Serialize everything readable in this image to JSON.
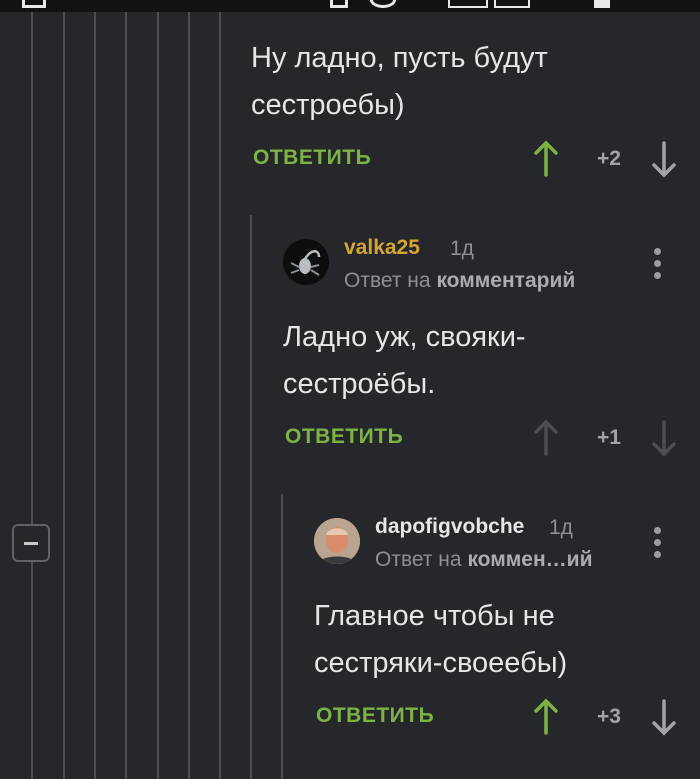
{
  "colors": {
    "background": "#25272a",
    "accent_green": "#7cb342",
    "username_gold": "#d4a72c",
    "username_light": "#e6e6e6",
    "muted": "#8d9094"
  },
  "comments": [
    {
      "text": "Ну ладно, пусть будут\nсестроебы)",
      "reply_label": "ОТВЕТИТЬ",
      "score": "+2",
      "upvoted": true
    },
    {
      "username": "valka25",
      "time": "1д",
      "reply_prefix": "Ответ на",
      "reply_target": "комментарий",
      "avatar_icon": "scorpion-avatar",
      "text": "Ладно уж, свояки-\nсестроёбы.",
      "reply_label": "ОТВЕТИТЬ",
      "score": "+1",
      "upvoted": false
    },
    {
      "username": "dapofigvobche",
      "time": "1д",
      "reply_prefix": "Ответ на",
      "reply_target": "коммен…ий",
      "avatar_icon": "user-photo-avatar",
      "text": "Главное чтобы не\nсестряки-своеебы)",
      "reply_label": "ОТВЕТИТЬ",
      "score": "+3",
      "upvoted": true
    }
  ]
}
